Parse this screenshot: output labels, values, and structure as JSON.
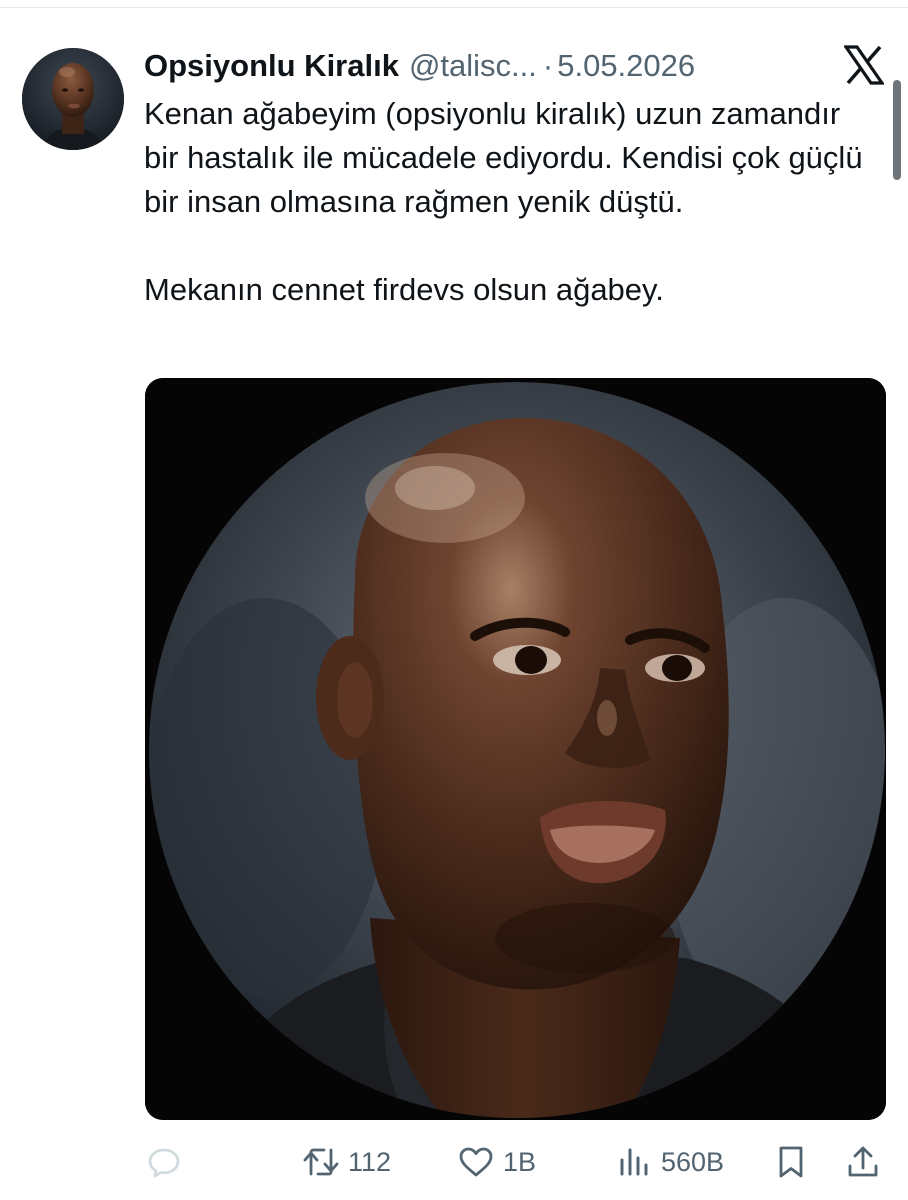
{
  "tweet": {
    "display_name": "Opsiyonlu Kiralık",
    "handle": "@talisc...",
    "separator": "·",
    "date": "5.05.2026",
    "text_paragraph_1": "Kenan ağabeyim (opsiyonlu kiralık) uzun zamandır bir hastalık ile mücadele ediyordu. Kendisi çok güçlü bir insan olmasına rağmen yenik düştü.",
    "text_paragraph_2": "Mekanın cennet firdevs olsun ağabey."
  },
  "actions": {
    "reply": {
      "icon": "reply-icon",
      "count": ""
    },
    "retweet": {
      "icon": "retweet-icon",
      "count": "112"
    },
    "like": {
      "icon": "heart-icon",
      "count": "1B"
    },
    "views": {
      "icon": "views-chart-icon",
      "count": "560B"
    },
    "bookmark": {
      "icon": "bookmark-icon"
    },
    "share": {
      "icon": "share-icon"
    }
  },
  "colors": {
    "text_primary": "#0f1419",
    "text_secondary": "#536471",
    "reply_icon_muted": "#cfd9de",
    "background": "#ffffff"
  }
}
